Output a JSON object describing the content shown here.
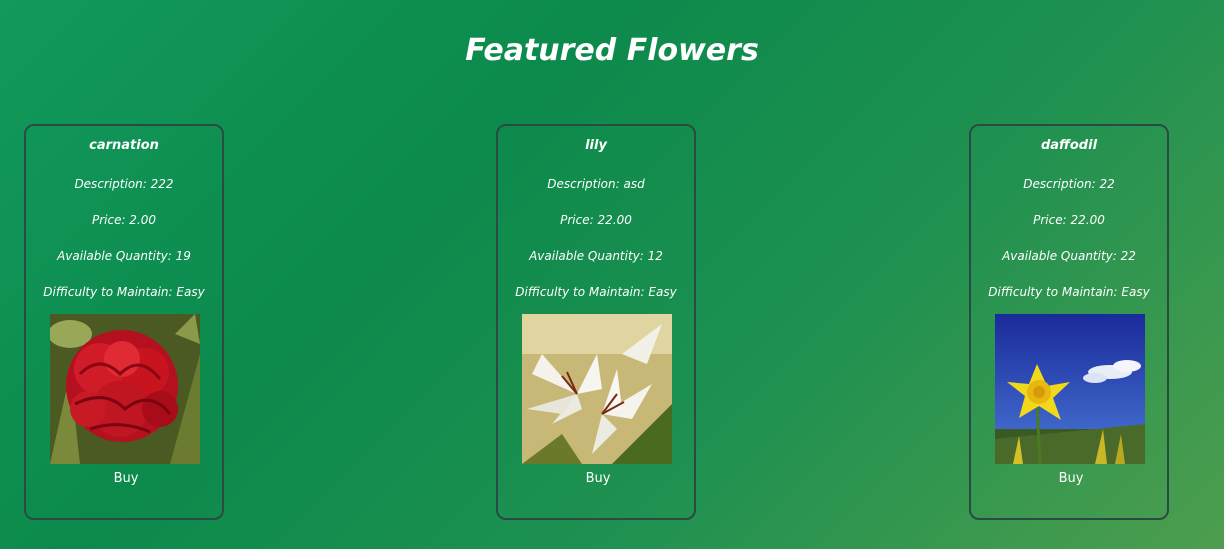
{
  "page": {
    "title": "Featured Flowers"
  },
  "products": [
    {
      "name": "carnation",
      "description": "Description: 222",
      "price": "Price: 2.00",
      "quantity": "Available Quantity: 19",
      "difficulty": "Difficulty to Maintain: Easy",
      "image_icon": "carnation-photo",
      "buy_label": "Buy"
    },
    {
      "name": "lily",
      "description": "Description: asd",
      "price": "Price: 22.00",
      "quantity": "Available Quantity: 12",
      "difficulty": "Difficulty to Maintain: Easy",
      "image_icon": "lily-photo",
      "buy_label": "Buy"
    },
    {
      "name": "daffodil",
      "description": "Description: 22",
      "price": "Price: 22.00",
      "quantity": "Available Quantity: 22",
      "difficulty": "Difficulty to Maintain: Easy",
      "image_icon": "daffodil-photo",
      "buy_label": "Buy"
    }
  ],
  "colors": {
    "background_start": "#12995c",
    "background_end": "#4d9e4e",
    "card_border": "#2b4a43",
    "text": "#ffffff"
  }
}
